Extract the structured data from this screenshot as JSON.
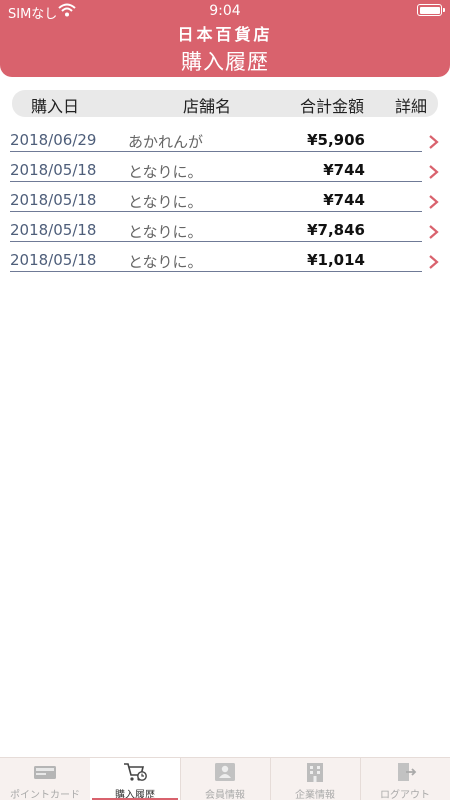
{
  "status": {
    "carrier": "SIMなし",
    "time": "9:04"
  },
  "header": {
    "brand": "日本百貨店",
    "title": "購入履歴"
  },
  "columns": {
    "purchase_date": "購入日",
    "shop": "店舗名",
    "total": "合計金額",
    "detail": "詳細"
  },
  "rows": [
    {
      "date": "2018/06/29",
      "shop": "あかれんが",
      "amount": "¥5,906"
    },
    {
      "date": "2018/05/18",
      "shop": "となりに。",
      "amount": "¥744"
    },
    {
      "date": "2018/05/18",
      "shop": "となりに。",
      "amount": "¥744"
    },
    {
      "date": "2018/05/18",
      "shop": "となりに。",
      "amount": "¥7,846"
    },
    {
      "date": "2018/05/18",
      "shop": "となりに。",
      "amount": "¥1,014"
    }
  ],
  "tabs": [
    {
      "label": "ポイントカード",
      "icon": "point-card-icon"
    },
    {
      "label": "購入履歴",
      "icon": "cart-clock-icon",
      "active": true
    },
    {
      "label": "会員情報",
      "icon": "member-card-icon"
    },
    {
      "label": "企業情報",
      "icon": "building-icon"
    },
    {
      "label": "ログアウト",
      "icon": "logout-icon"
    }
  ],
  "colors": {
    "accent": "#d9626d",
    "date_text": "#4e5e7a",
    "chevron": "#d9626d"
  }
}
